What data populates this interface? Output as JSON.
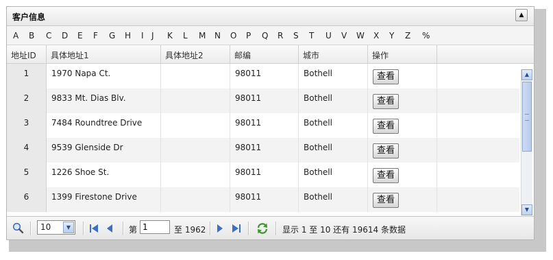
{
  "panel": {
    "title": "客户信息",
    "collapse_icon": "▲"
  },
  "letters": [
    "A",
    "B",
    "C",
    "D",
    "E",
    "F",
    "G",
    "H",
    "I",
    "J",
    "K",
    "L",
    "M",
    "N",
    "O",
    "P",
    "Q",
    "R",
    "S",
    "T",
    "U",
    "V",
    "W",
    "X",
    "Y",
    "Z",
    "%"
  ],
  "columns": [
    "地址ID",
    "具体地址1",
    "具体地址2",
    "邮编",
    "城市",
    "操作"
  ],
  "rows": [
    {
      "id": "1",
      "addr1": "1970 Napa Ct.",
      "addr2": "",
      "zip": "98011",
      "city": "Bothell",
      "action": "查看"
    },
    {
      "id": "2",
      "addr1": "9833 Mt. Dias Blv.",
      "addr2": "",
      "zip": "98011",
      "city": "Bothell",
      "action": "查看"
    },
    {
      "id": "3",
      "addr1": "7484 Roundtree Drive",
      "addr2": "",
      "zip": "98011",
      "city": "Bothell",
      "action": "查看"
    },
    {
      "id": "4",
      "addr1": "9539 Glenside Dr",
      "addr2": "",
      "zip": "98011",
      "city": "Bothell",
      "action": "查看"
    },
    {
      "id": "5",
      "addr1": "1226 Shoe St.",
      "addr2": "",
      "zip": "98011",
      "city": "Bothell",
      "action": "查看"
    },
    {
      "id": "6",
      "addr1": "1399 Firestone Drive",
      "addr2": "",
      "zip": "98011",
      "city": "Bothell",
      "action": "查看"
    }
  ],
  "pager": {
    "page_size": "10",
    "page_prefix": "第",
    "current_page": "1",
    "page_suffix": "至 1962",
    "status": "显示 1 至 10 还有 19614 条数据"
  },
  "icons": {
    "search": "search-icon",
    "first": "first-page-icon",
    "prev": "prev-page-icon",
    "next": "next-page-icon",
    "last": "last-page-icon",
    "refresh": "refresh-icon",
    "scroll_up": "scroll-up-icon",
    "scroll_down": "scroll-down-icon"
  },
  "colors": {
    "accent": "#3d6fc4",
    "refresh": "#3f9a2e",
    "row_alt": "#f3f3f3"
  }
}
